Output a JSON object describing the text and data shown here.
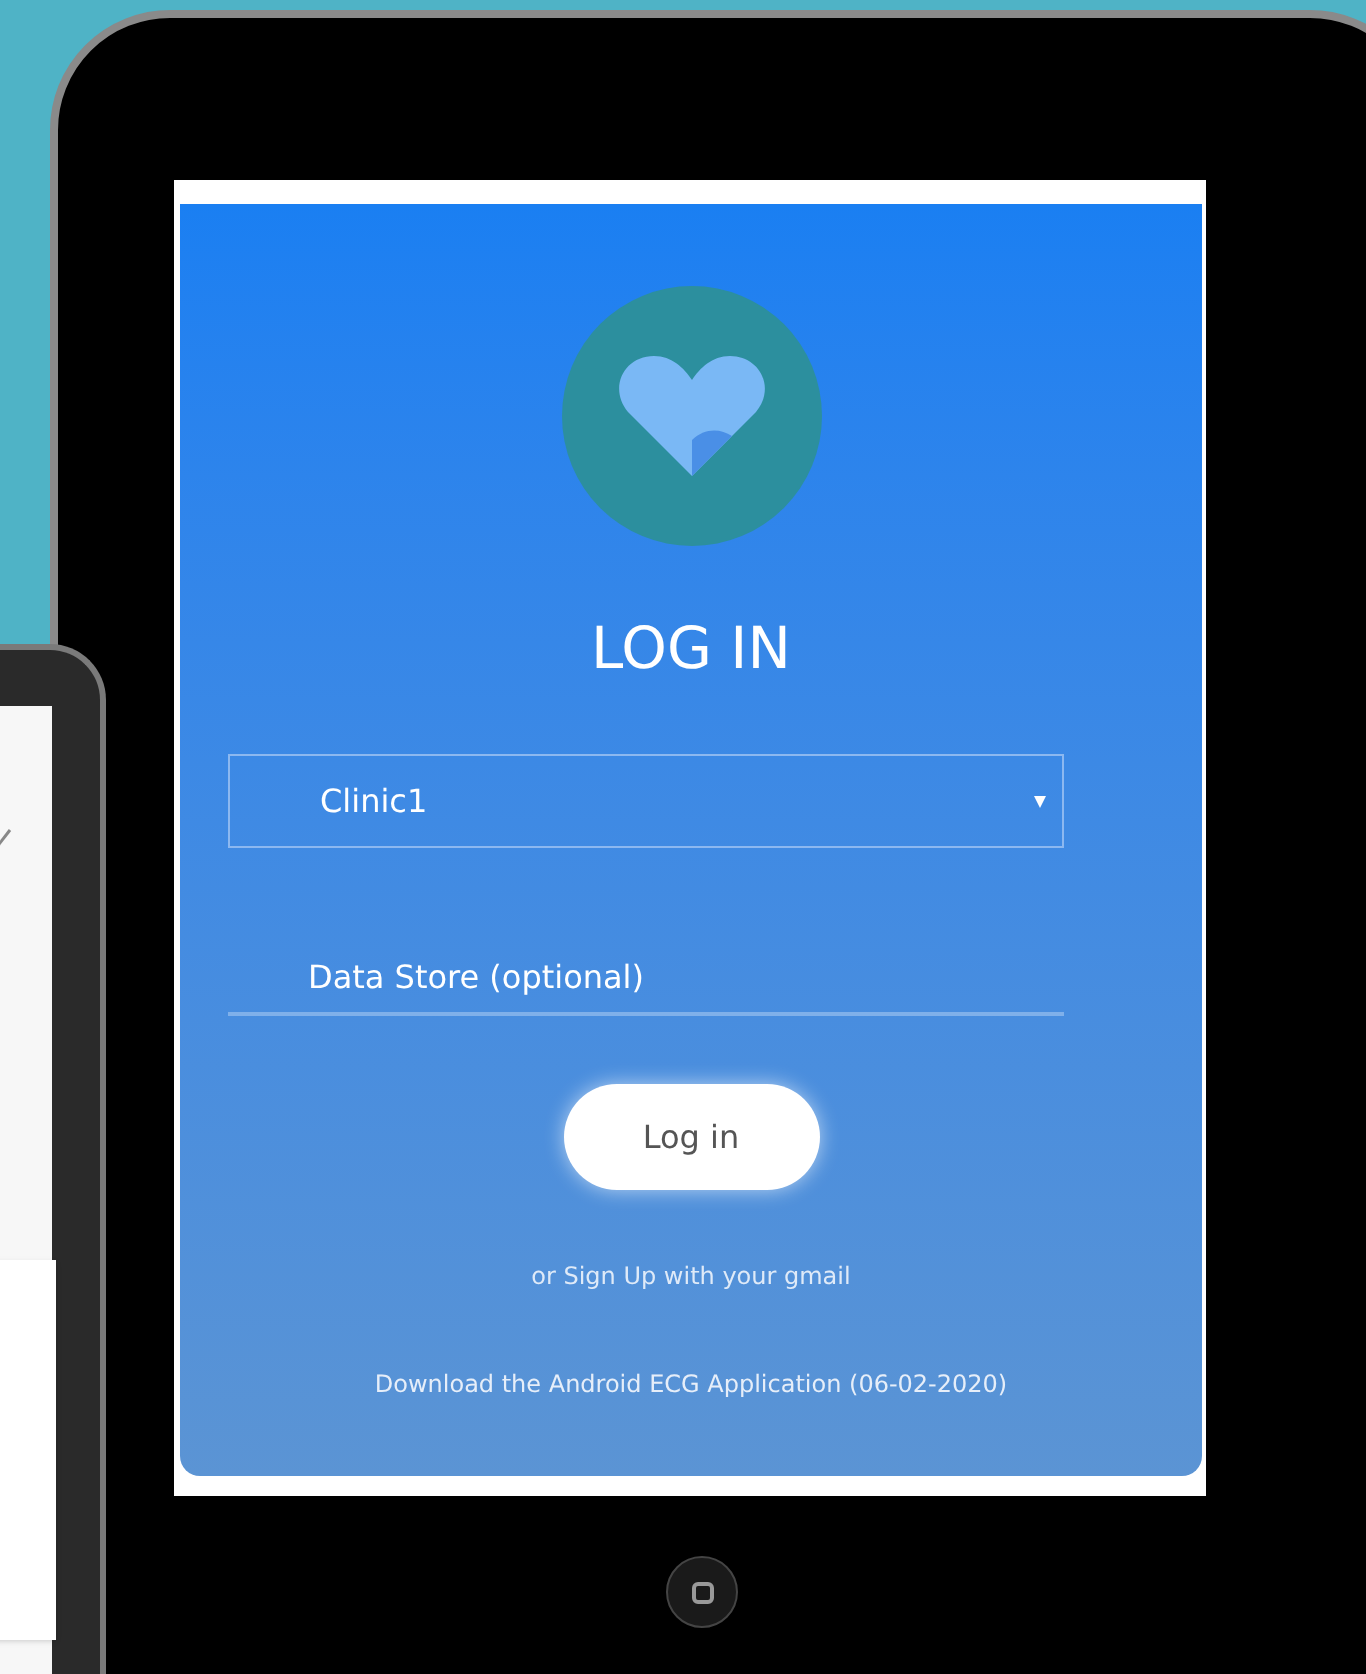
{
  "login": {
    "title": "LOG IN",
    "clinic_select": {
      "value": "Clinic1"
    },
    "data_store": {
      "placeholder": "Data Store (optional)"
    },
    "button": "Log in",
    "signup_link": "or Sign Up with your gmail",
    "download_link": "Download the Android ECG Application (06-02-2020)"
  }
}
